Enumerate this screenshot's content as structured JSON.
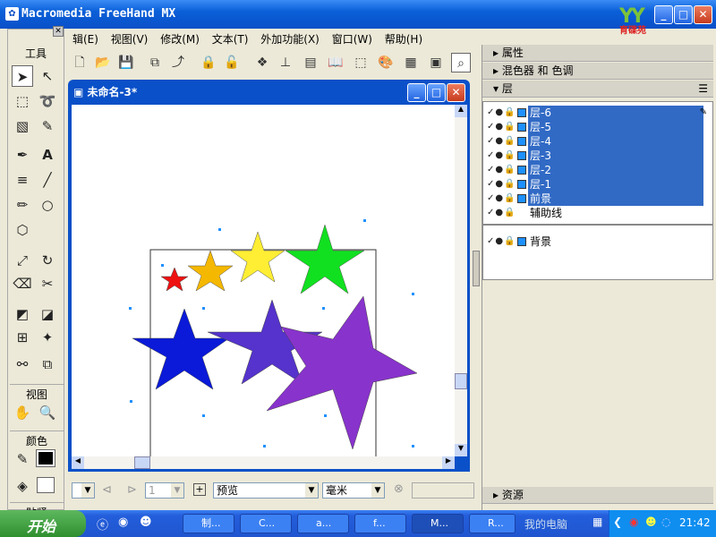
{
  "app": {
    "title": "Macromedia FreeHand MX",
    "logo_caption": "育碟苑",
    "logo_letters": "YY"
  },
  "window_buttons": {
    "minimize": "_",
    "maximize": "□",
    "close": "✕"
  },
  "menu": [
    "辑(E)",
    "视图(V)",
    "修改(M)",
    "文本(T)",
    "外加功能(X)",
    "窗口(W)",
    "帮助(H)"
  ],
  "tools": {
    "title": "工具",
    "view_section": "视图",
    "color_section": "颜色",
    "bottom_section": "贴紧"
  },
  "document": {
    "title": "未命名-3*"
  },
  "status": {
    "mode": "预览",
    "unit": "毫米",
    "page": "1"
  },
  "panels": {
    "properties": "属性",
    "mixer": "混色器 和 色调",
    "layers": "层",
    "assets": "资源"
  },
  "layers": [
    {
      "name": "层-6",
      "highlighted": true
    },
    {
      "name": "层-5",
      "highlighted": true
    },
    {
      "name": "层-4",
      "highlighted": true
    },
    {
      "name": "层-3",
      "highlighted": true
    },
    {
      "name": "层-2",
      "highlighted": true
    },
    {
      "name": "层-1",
      "highlighted": true
    },
    {
      "name": "前景",
      "highlighted": true
    },
    {
      "name": "辅助线",
      "highlighted": false
    },
    {
      "name": "背景",
      "highlighted": false
    }
  ],
  "taskbar": {
    "start": "开始",
    "tasks": [
      "制...",
      "C...",
      "a...",
      "f...",
      "M...",
      "R..."
    ],
    "computer": "我的电脑",
    "clock": "21:42"
  },
  "colors": {
    "selection": "#316ac5",
    "titlebar": "#0a50c8",
    "swatch": "#1e90ff"
  }
}
